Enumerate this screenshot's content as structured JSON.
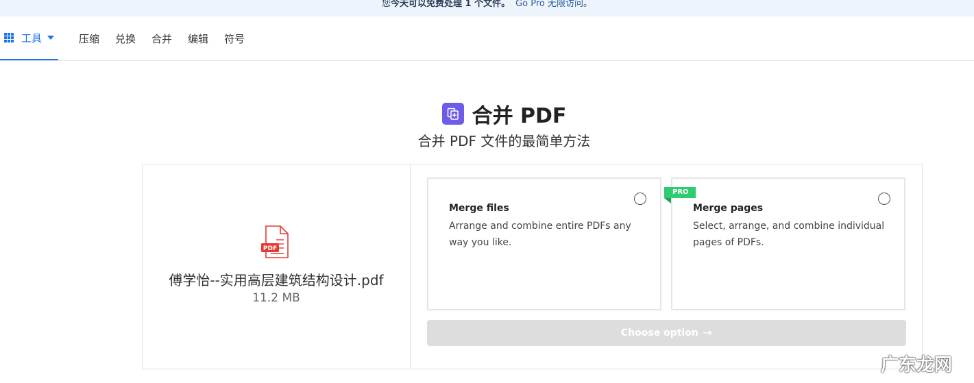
{
  "banner": {
    "text_prefix": "您",
    "text_strong": "今天可以免费处理 1 个文件。",
    "link": "Go Pro 无限访问。"
  },
  "nav": {
    "tools_label": "工具",
    "items": [
      "压缩",
      "兑换",
      "合并",
      "编辑",
      "符号"
    ]
  },
  "header": {
    "title": "合并 PDF",
    "subtitle": "合并 PDF 文件的最简单方法"
  },
  "file": {
    "icon_label": "PDF",
    "name": "傅学怡--实用高层建筑结构设计.pdf",
    "size": "11.2 MB"
  },
  "options": [
    {
      "title": "Merge files",
      "description": "Arrange and combine entire PDFs any way you like."
    },
    {
      "title": "Merge pages",
      "description": "Select, arrange, and combine individual pages of PDFs.",
      "badge": "PRO"
    }
  ],
  "choose_button": {
    "label": "Choose option",
    "arrow": "→"
  },
  "watermark": "广东龙网",
  "colors": {
    "accent": "#1a73e8",
    "merge_icon": "#6c5ce7",
    "pro_badge": "#2dcc70",
    "pdf_red": "#e53935",
    "button_disabled": "#dddddd"
  }
}
